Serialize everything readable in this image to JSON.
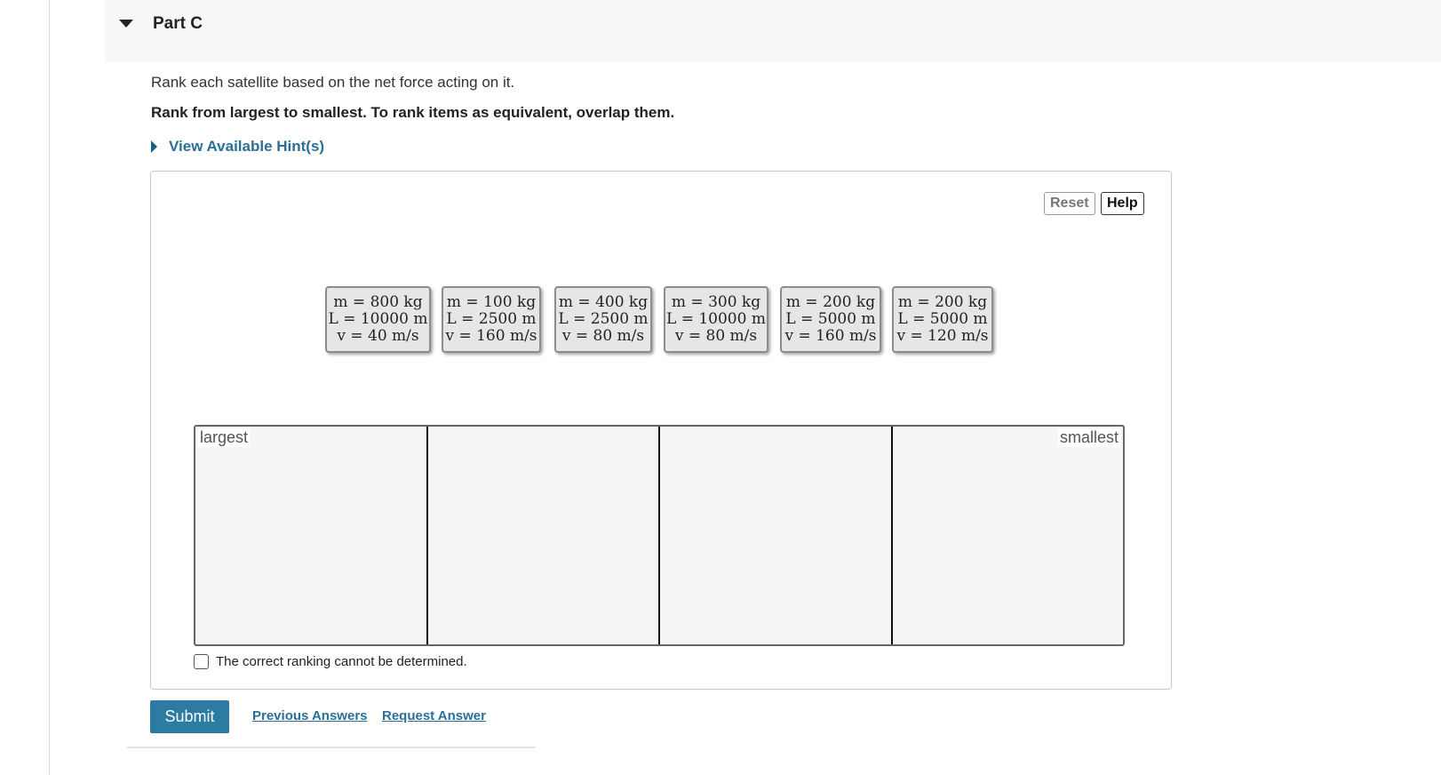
{
  "part": {
    "title": "Part C"
  },
  "question": {
    "instruction": "Rank each satellite based on the net force acting on it.",
    "instruction_bold": "Rank from largest to smallest. To rank items as equivalent, overlap them."
  },
  "hints": {
    "label": "View Available Hint(s)"
  },
  "toolbar": {
    "reset_label": "Reset",
    "help_label": "Help"
  },
  "tiles": [
    {
      "m": "m = 800 kg",
      "L": "L = 10000 m",
      "v": "v = 40 m/s"
    },
    {
      "m": "m = 100 kg",
      "L": "L = 2500 m",
      "v": "v = 160 m/s"
    },
    {
      "m": "m = 400 kg",
      "L": "L = 2500 m",
      "v": "v = 80 m/s"
    },
    {
      "m": "m = 300 kg",
      "L": "L = 10000 m",
      "v": "v = 80 m/s"
    },
    {
      "m": "m = 200 kg",
      "L": "L = 5000 m",
      "v": "v = 160 m/s"
    },
    {
      "m": "m = 200 kg",
      "L": "L = 5000 m",
      "v": "v = 120 m/s"
    }
  ],
  "ranking": {
    "largest_label": "largest",
    "smallest_label": "smallest"
  },
  "cannot_determine": {
    "label": "The correct ranking cannot be determined.",
    "checked": false
  },
  "actions": {
    "submit_label": "Submit",
    "previous_answers_label": "Previous Answers",
    "request_answer_label": "Request Answer"
  }
}
